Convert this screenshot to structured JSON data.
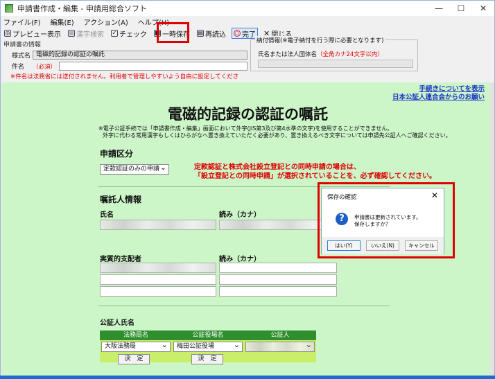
{
  "window": {
    "title": "申請書作成・編集 - 申請用総合ソフト",
    "controls": [
      "—",
      "☐",
      "✕"
    ]
  },
  "menu": [
    "ファイル(F)",
    "編集(E)",
    "アクション(A)",
    "ヘルプ(H)"
  ],
  "toolbar": {
    "preview": "プレビュー表示",
    "kanji_search": "漢字検索",
    "check": "チェック",
    "temp_save": "一時保存",
    "reload": "再読込",
    "complete": "完了",
    "close": "閉じる"
  },
  "app_info": {
    "header": "申請書の情報",
    "format_label": "様式名",
    "format_value": "電磁的記録の認証の嘱託",
    "name_label": "件名",
    "required": "（必須）",
    "name_value": "",
    "note": "※件名は法務省には送付されません。利用者で管理しやすいよう自由に設定してください。"
  },
  "payment_info": {
    "header": "納付情報(※電子納付を行う際に必要となります)",
    "label": "氏名または法人団体名",
    "hint": "（全角カナ24文字以内）"
  },
  "links": [
    "手続きについてを表示",
    "日本公証人連合会からのお願い"
  ],
  "form": {
    "title": "電磁的記録の認証の嘱託",
    "warning1": "※電子公証手続では「申請書作成・編集」画面において外字(JIS第3及び第4水準の文字)を使用することができません。",
    "warning2": "外字に代わる常用漢字もしくはひらがなへ置き換えていただく必要があり、置き換えるべき文字については申請先公証人へご確認ください。",
    "section_apply": "申請区分",
    "apply_select": "定款認証のみの申請",
    "apply_note1": "定款認証と株式会社設立登記との同時申請の場合は、",
    "apply_note2": "「設立登記との同時申請」が選択されていることを、必ず確認してください。",
    "section_client": "嘱託人情報",
    "name_label": "氏名",
    "kana_label": "読み（カナ）",
    "beneficial_label": "実質的支配者",
    "kana_label2": "読み（カナ）",
    "section_notary": "公証人氏名",
    "col_bureau": "法務局名",
    "col_office": "公証役場名",
    "col_notary": "公証人",
    "bureau_value": "大阪法務局",
    "office_value": "梅田公証役場",
    "decide": "決　定"
  },
  "dialog": {
    "title": "保存の確認",
    "close": "✕",
    "icon": "?",
    "message1": "申請書は更新されています。",
    "message2": "保存しますか？",
    "yes": "はい(Y)",
    "no": "いいえ(N)",
    "cancel": "キャンセル"
  },
  "colors": {
    "form_bg": "#ccf5c8",
    "accent_red": "#e00000",
    "header_green": "#2f8f2f",
    "cell_yellowgreen": "#c8ee6a"
  }
}
